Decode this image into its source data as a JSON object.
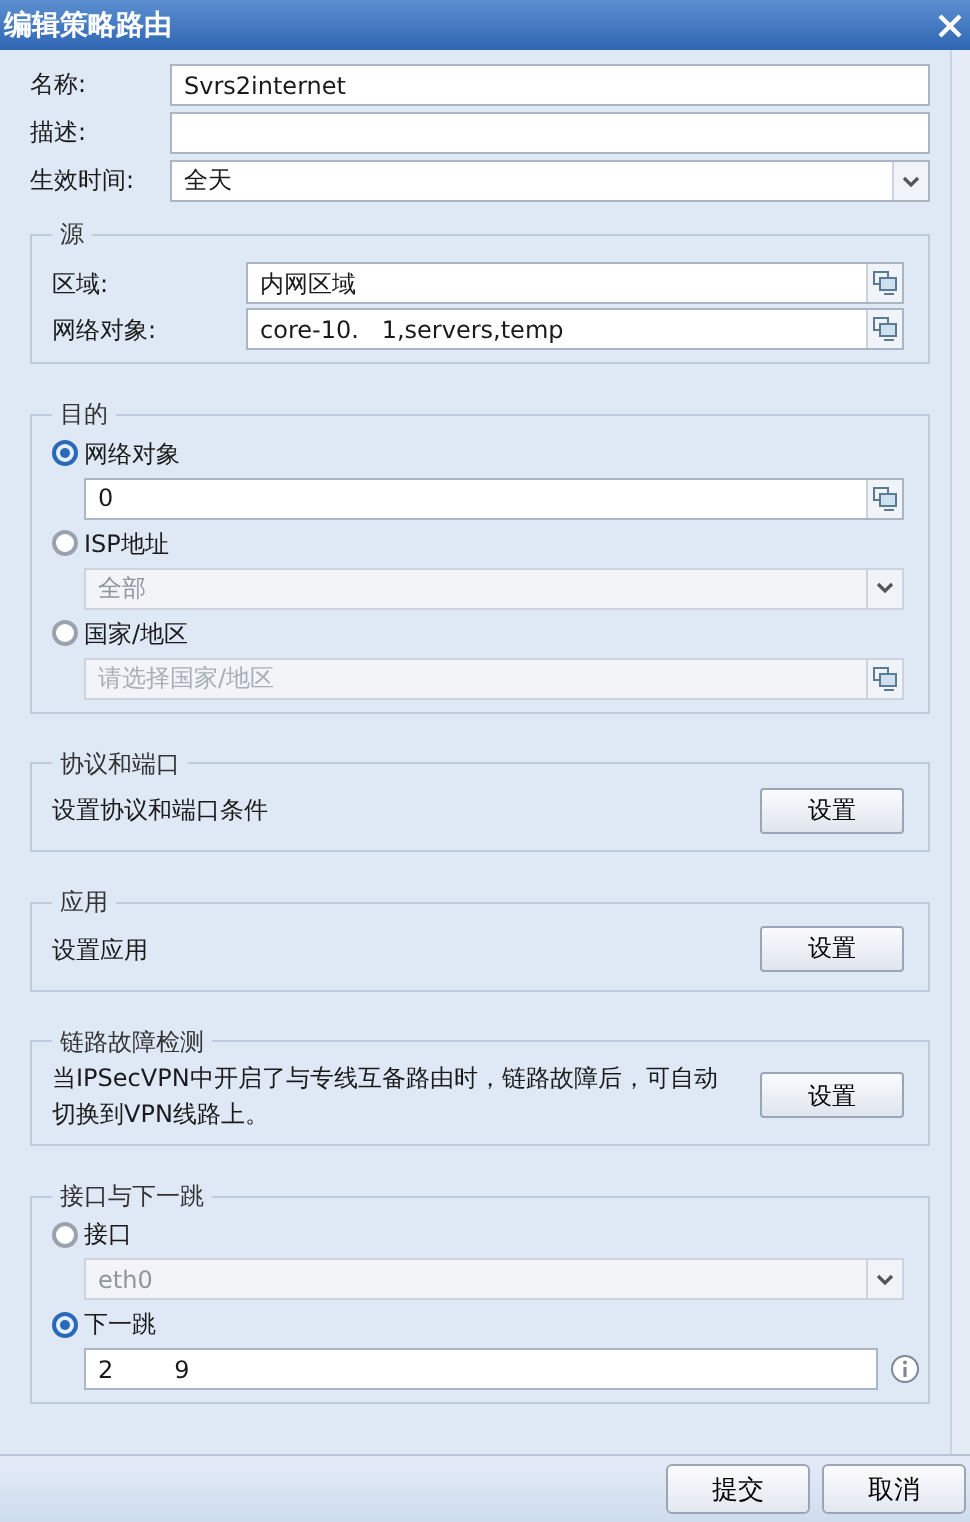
{
  "window": {
    "title": "编辑策略路由"
  },
  "fields": [
    {
      "kind": "text",
      "label": "名称:",
      "value": "Svrs2internet"
    },
    {
      "kind": "text",
      "label": "描述:"
    },
    {
      "kind": "select",
      "label": "生效时间:",
      "value": "全天"
    }
  ],
  "source": {
    "legend": "源",
    "rows": [
      {
        "label": "区域:",
        "value": "内网区域"
      },
      {
        "label": "网络对象:",
        "value": "core-10.   1,servers,temp"
      }
    ]
  },
  "destination": {
    "legend": "目的",
    "options": [
      {
        "label": "网络对象",
        "selected": true,
        "kind": "picker",
        "value": "0"
      },
      {
        "label": "ISP地址",
        "selected": false,
        "kind": "select",
        "value": "全部"
      },
      {
        "label": "国家/地区",
        "selected": false,
        "kind": "picker",
        "placeholder": "请选择国家/地区"
      }
    ]
  },
  "sections": [
    {
      "legend": "协议和端口",
      "text": "设置协议和端口条件",
      "button": "设置"
    },
    {
      "legend": "应用",
      "text": "设置应用",
      "button": "设置"
    },
    {
      "legend": "链路故障检测",
      "text": "当IPSecVPN中开启了与专线互备路由时，链路故障后，可自动切换到VPN线路上。",
      "button": "设置"
    }
  ],
  "next_hop": {
    "legend": "接口与下一跳",
    "options": [
      {
        "label": "接口",
        "selected": false,
        "kind": "select",
        "value": "eth0"
      },
      {
        "label": "下一跳",
        "selected": true,
        "kind": "info",
        "value": "2        9"
      }
    ]
  },
  "buttons": [
    "提交",
    "取消"
  ]
}
